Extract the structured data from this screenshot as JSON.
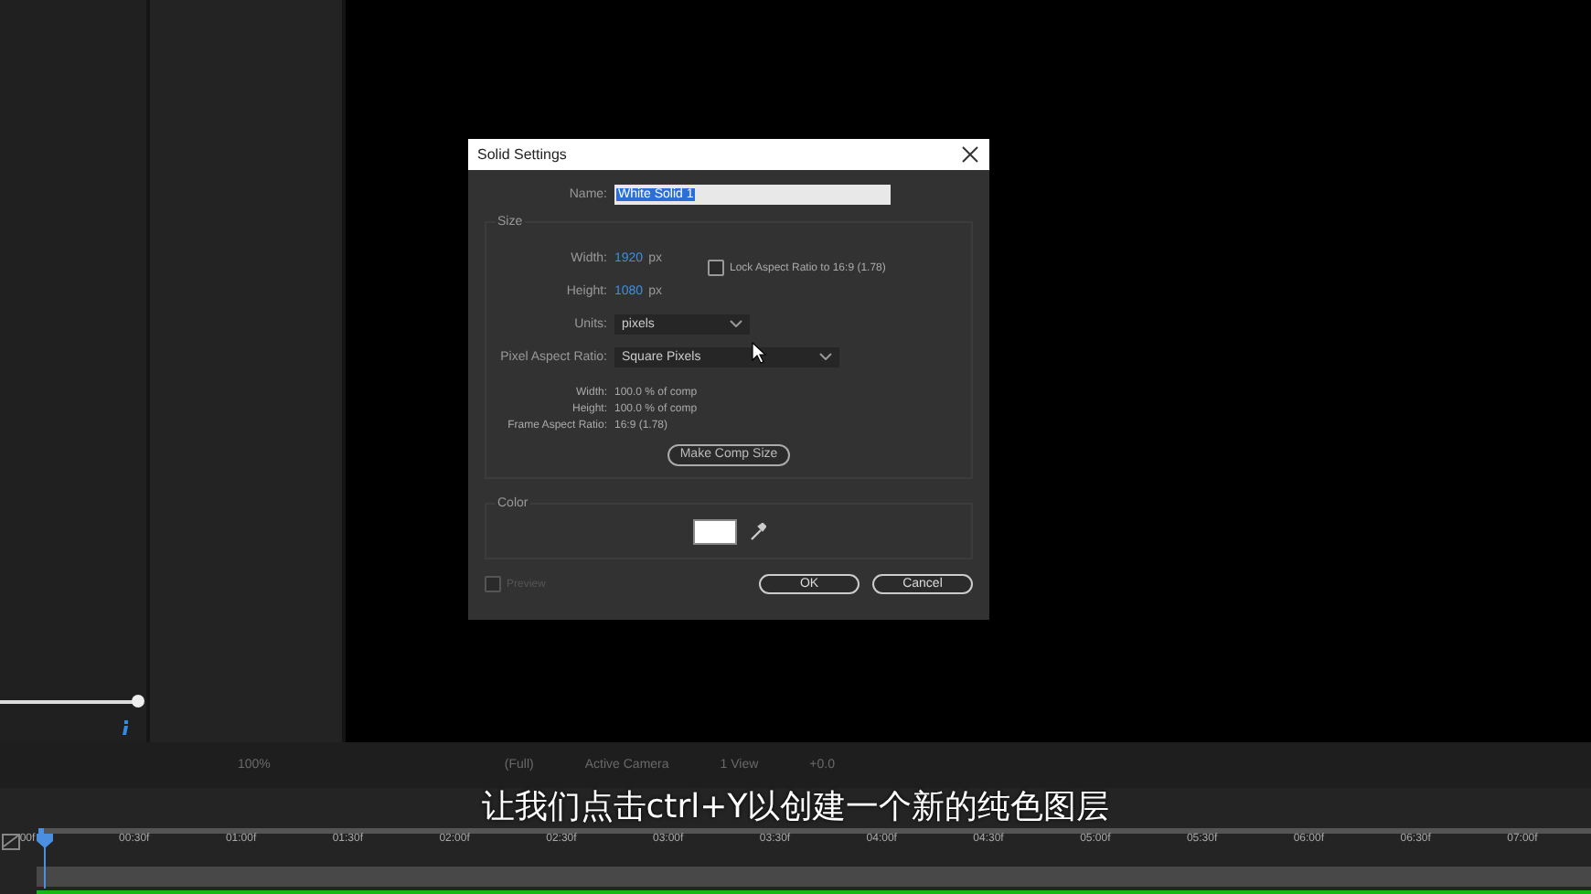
{
  "left_panel": {
    "slider": {
      "level": 1
    }
  },
  "viewer_toolbar": [
    "100%",
    "(Full)",
    "Active Camera",
    "1 View",
    "+0.0"
  ],
  "dialog": {
    "title": "Solid Settings",
    "name_label": "Name:",
    "name_value": "White Solid 1",
    "size": {
      "legend": "Size",
      "width_label": "Width:",
      "width_value": "1920",
      "width_unit": "px",
      "height_label": "Height:",
      "height_value": "1080",
      "height_unit": "px",
      "lock": {
        "label": "Lock Aspect Ratio to 16:9 (1.78)",
        "checked": false
      },
      "units_label": "Units:",
      "units_value": "pixels",
      "par_label": "Pixel Aspect Ratio:",
      "par_value": "Square Pixels",
      "info": [
        {
          "label": "Width:",
          "value": "100.0 % of comp"
        },
        {
          "label": "Height:",
          "value": "100.0 % of comp"
        },
        {
          "label": "Frame Aspect Ratio:",
          "value": "16:9 (1.78)"
        }
      ],
      "comp_button": "Make Comp Size"
    },
    "color": {
      "legend": "Color"
    },
    "preview": {
      "label": "Preview",
      "checked": false,
      "disabled": true
    },
    "buttons": [
      "OK",
      "Cancel"
    ]
  },
  "timeline": {
    "ticks": [
      "00f",
      "00:30f",
      "01:00f",
      "01:30f",
      "02:00f",
      "02:30f",
      "03:00f",
      "03:30f",
      "04:00f",
      "04:30f",
      "05:00f",
      "05:30f",
      "06:00f",
      "06:30f",
      "07:00f"
    ]
  },
  "subtitle": "让我们点击ctrl+Y以创建一个新的纯色图层"
}
